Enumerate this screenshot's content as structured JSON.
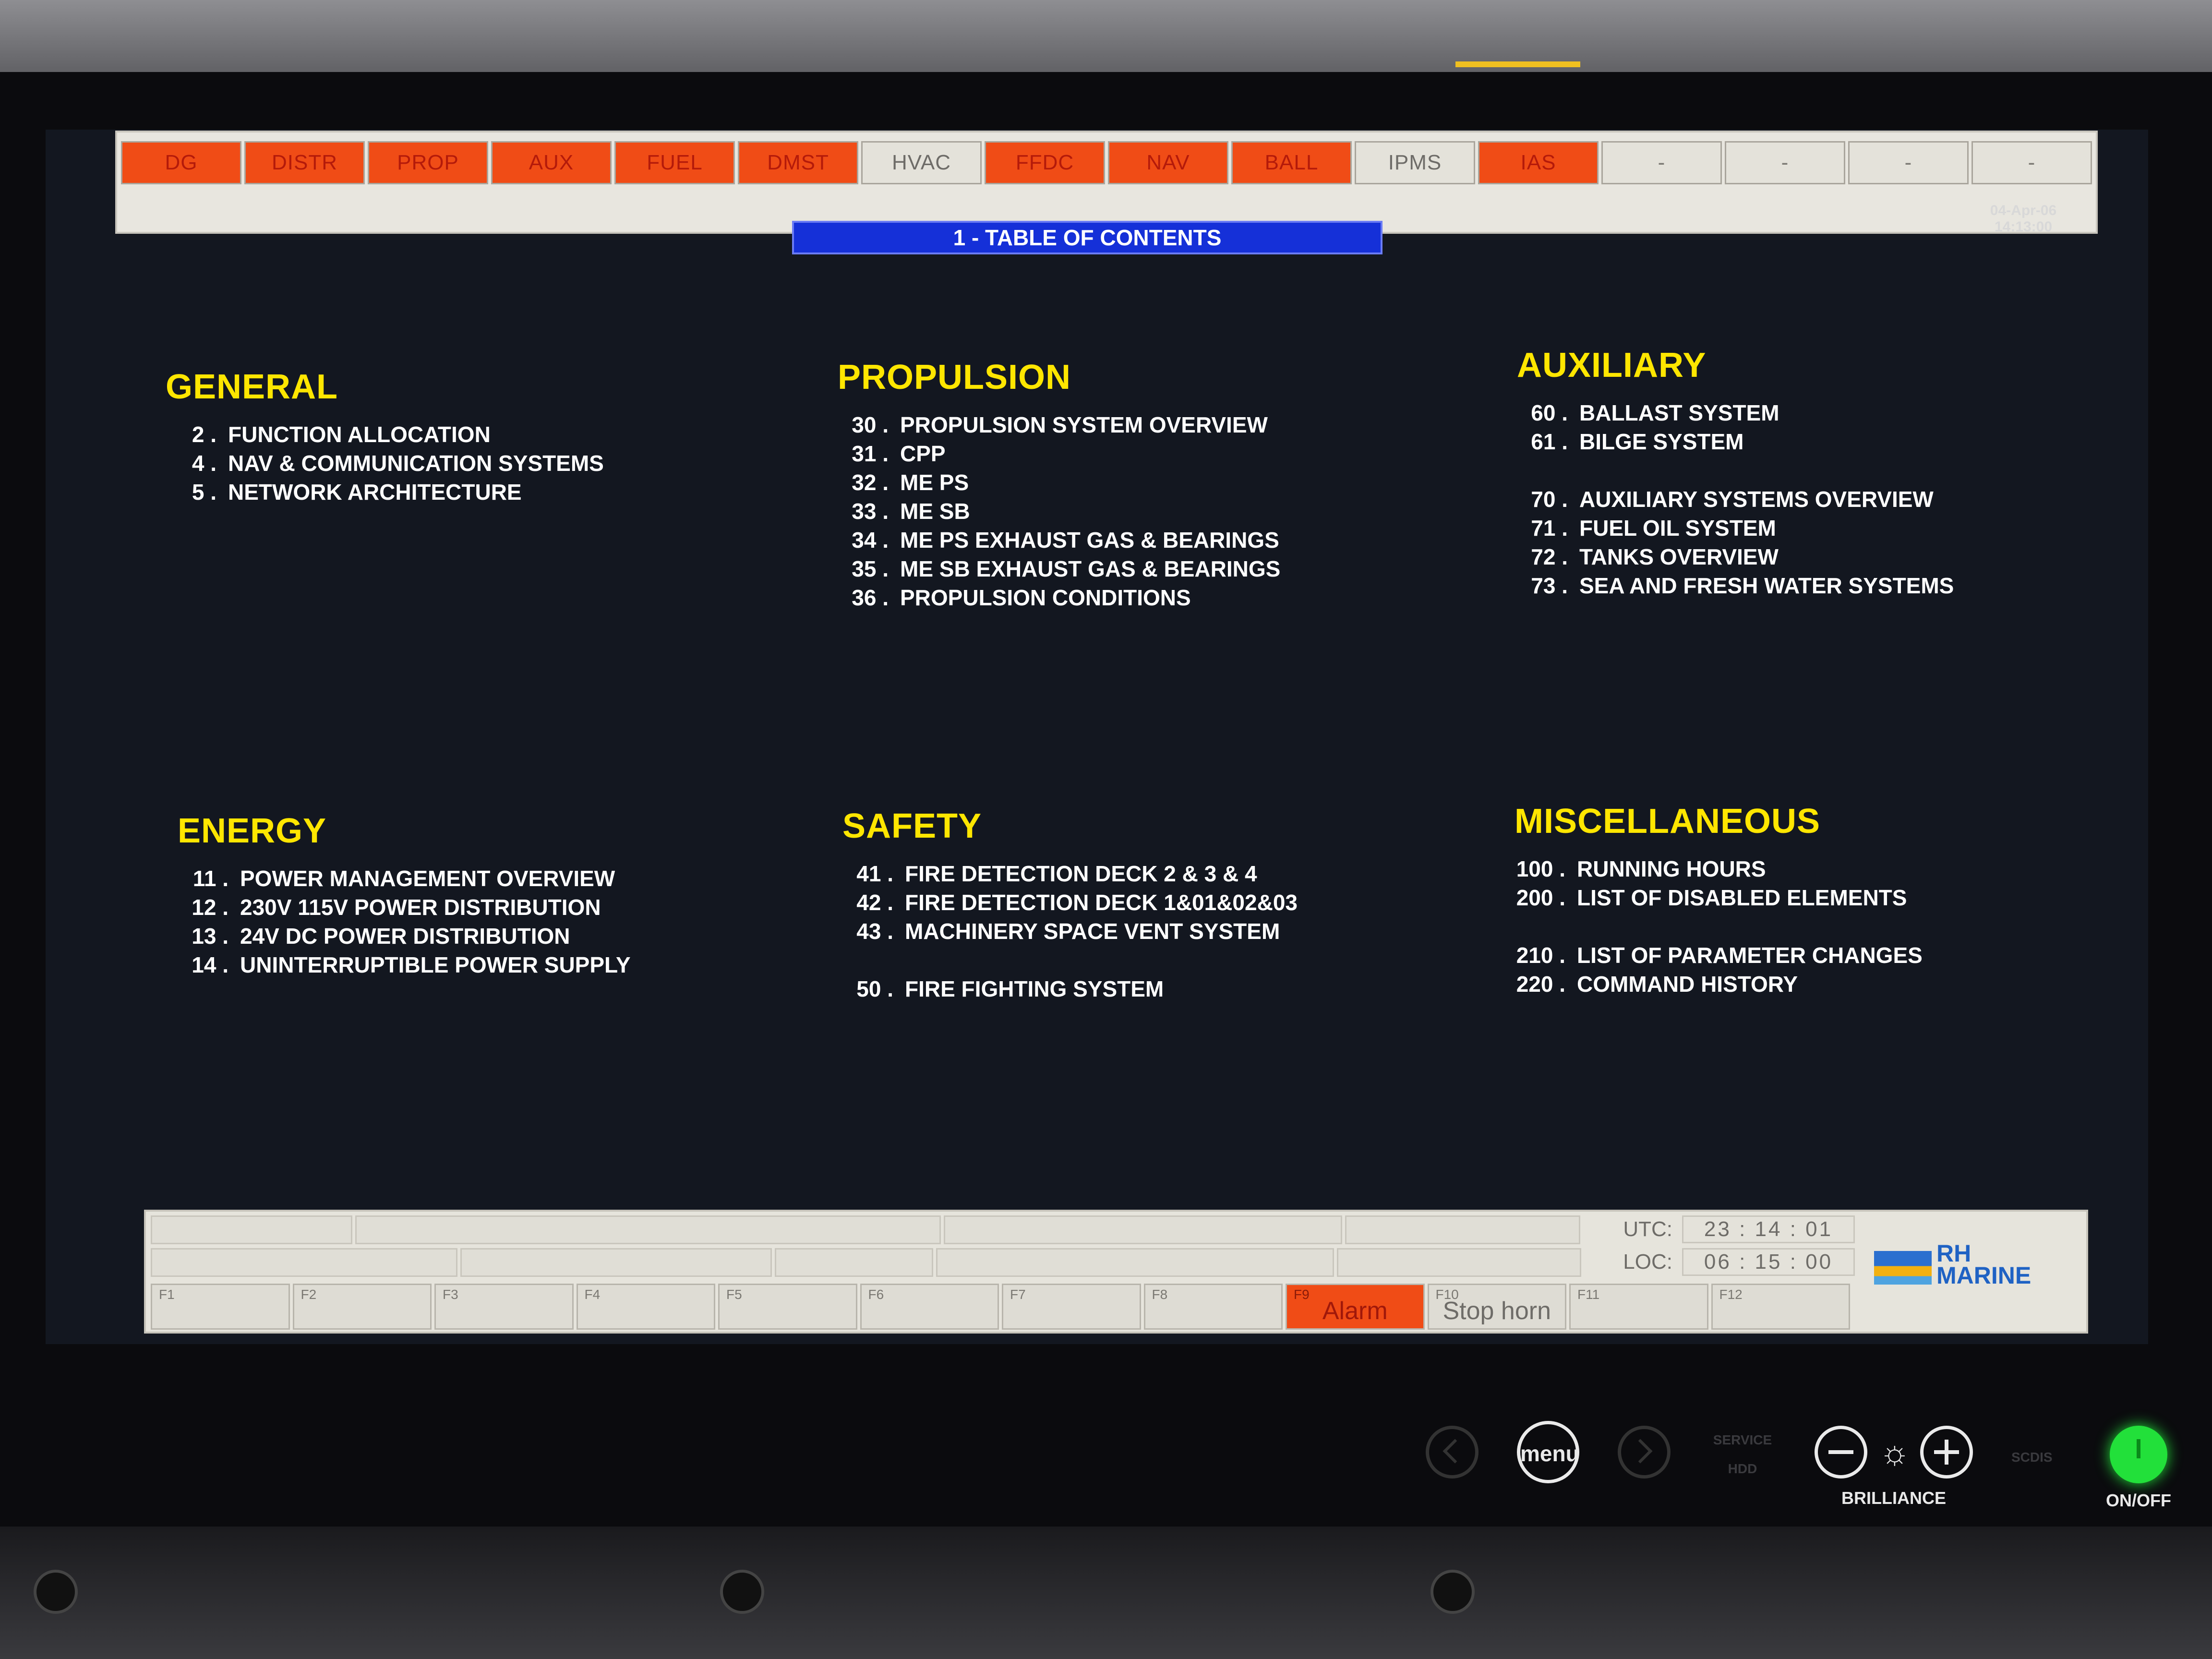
{
  "tabs": [
    {
      "label": "DG",
      "state": "alarm"
    },
    {
      "label": "DISTR",
      "state": "alarm"
    },
    {
      "label": "PROP",
      "state": "alarm"
    },
    {
      "label": "AUX",
      "state": "alarm"
    },
    {
      "label": "FUEL",
      "state": "alarm"
    },
    {
      "label": "DMST",
      "state": "alarm"
    },
    {
      "label": "HVAC",
      "state": "normal"
    },
    {
      "label": "FFDC",
      "state": "alarm"
    },
    {
      "label": "NAV",
      "state": "alarm"
    },
    {
      "label": "BALL",
      "state": "alarm"
    },
    {
      "label": "IPMS",
      "state": "normal"
    },
    {
      "label": "IAS",
      "state": "alarm"
    },
    {
      "label": "-",
      "state": "empty"
    },
    {
      "label": "-",
      "state": "empty"
    },
    {
      "label": "-",
      "state": "empty"
    },
    {
      "label": "-",
      "state": "empty"
    }
  ],
  "page_title": "1 - TABLE OF CONTENTS",
  "datetime": {
    "date": "04-Apr-06",
    "time": "14:13:00"
  },
  "sections": {
    "general": {
      "title": "GENERAL",
      "items": [
        {
          "num": "2 .",
          "label": "FUNCTION ALLOCATION"
        },
        {
          "num": "4 .",
          "label": "NAV & COMMUNICATION SYSTEMS"
        },
        {
          "num": "5 .",
          "label": "NETWORK ARCHITECTURE"
        }
      ]
    },
    "propulsion": {
      "title": "PROPULSION",
      "items": [
        {
          "num": "30 .",
          "label": "PROPULSION SYSTEM OVERVIEW"
        },
        {
          "num": "31 .",
          "label": "CPP"
        },
        {
          "num": "32 .",
          "label": "ME PS"
        },
        {
          "num": "33 .",
          "label": "ME SB"
        },
        {
          "num": "34 .",
          "label": "ME PS EXHAUST GAS & BEARINGS"
        },
        {
          "num": "35 .",
          "label": "ME SB EXHAUST GAS & BEARINGS"
        },
        {
          "num": "36 .",
          "label": "PROPULSION CONDITIONS"
        }
      ]
    },
    "auxiliary": {
      "title": "AUXILIARY",
      "items_a": [
        {
          "num": "60 .",
          "label": "BALLAST SYSTEM"
        },
        {
          "num": "61 .",
          "label": "BILGE SYSTEM"
        }
      ],
      "items_b": [
        {
          "num": "70 .",
          "label": "AUXILIARY SYSTEMS OVERVIEW"
        },
        {
          "num": "71 .",
          "label": "FUEL OIL SYSTEM"
        },
        {
          "num": "72 .",
          "label": "TANKS OVERVIEW"
        },
        {
          "num": "73 .",
          "label": "SEA AND FRESH WATER SYSTEMS"
        }
      ]
    },
    "energy": {
      "title": "ENERGY",
      "items": [
        {
          "num": "11 .",
          "label": "POWER MANAGEMENT OVERVIEW"
        },
        {
          "num": "12 .",
          "label": "230V 115V POWER DISTRIBUTION"
        },
        {
          "num": "13 .",
          "label": "24V DC POWER DISTRIBUTION"
        },
        {
          "num": "14 .",
          "label": "UNINTERRUPTIBLE POWER SUPPLY"
        }
      ]
    },
    "safety": {
      "title": "SAFETY",
      "items_a": [
        {
          "num": "41 .",
          "label": "FIRE DETECTION DECK 2 & 3 & 4"
        },
        {
          "num": "42 .",
          "label": "FIRE DETECTION DECK 1&01&02&03"
        },
        {
          "num": "43 .",
          "label": "MACHINERY SPACE VENT SYSTEM"
        }
      ],
      "items_b": [
        {
          "num": "50 .",
          "label": "FIRE FIGHTING SYSTEM"
        }
      ]
    },
    "misc": {
      "title": "MISCELLANEOUS",
      "items_a": [
        {
          "num": "100 .",
          "label": "RUNNING HOURS"
        },
        {
          "num": "200 .",
          "label": "LIST OF DISABLED ELEMENTS"
        }
      ],
      "items_b": [
        {
          "num": "210 .",
          "label": "LIST OF PARAMETER CHANGES"
        },
        {
          "num": "220 .",
          "label": "COMMAND HISTORY"
        }
      ]
    }
  },
  "clock": {
    "utc_label": "UTC:",
    "utc_value": "23 : 14 : 01",
    "loc_label": "LOC:",
    "loc_value": "06 : 15 : 00"
  },
  "function_keys": [
    {
      "key": "F1",
      "label": "",
      "state": "normal"
    },
    {
      "key": "F2",
      "label": "",
      "state": "normal"
    },
    {
      "key": "F3",
      "label": "",
      "state": "normal"
    },
    {
      "key": "F4",
      "label": "",
      "state": "normal"
    },
    {
      "key": "F5",
      "label": "",
      "state": "normal"
    },
    {
      "key": "F6",
      "label": "",
      "state": "normal"
    },
    {
      "key": "F7",
      "label": "",
      "state": "normal"
    },
    {
      "key": "F8",
      "label": "",
      "state": "normal"
    },
    {
      "key": "F9",
      "label": "Alarm",
      "state": "alarm"
    },
    {
      "key": "F10",
      "label": "Stop horn",
      "state": "normal"
    },
    {
      "key": "F11",
      "label": "",
      "state": "normal"
    },
    {
      "key": "F12",
      "label": "",
      "state": "normal"
    }
  ],
  "logo": {
    "line1": "RH",
    "line2": "MARINE"
  },
  "hardware": {
    "menu": "menu",
    "brilliance": "BRILLIANCE",
    "onoff": "ON/OFF",
    "service": "SERVICE",
    "hdd": "HDD",
    "scdis": "SCDIS"
  },
  "colors": {
    "alarm": "#f04c16",
    "heading": "#ffe600",
    "title_bar": "#1530d8",
    "power_led": "#22e03a"
  }
}
